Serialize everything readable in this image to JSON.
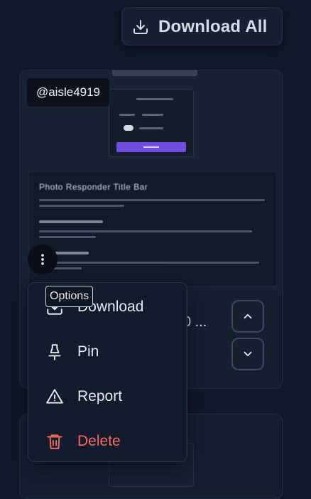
{
  "toolbar": {
    "download_all_label": "Download All",
    "icon": "download-icon"
  },
  "card": {
    "username": "@aisle4919",
    "options_tooltip": "Options",
    "truncated_text": "0 ...",
    "preview": {
      "heading": "Photo Responder Title Bar"
    }
  },
  "menu": {
    "items": [
      {
        "label": "Download",
        "icon": "download-icon"
      },
      {
        "label": "Pin",
        "icon": "pin-icon"
      },
      {
        "label": "Report",
        "icon": "warning-icon"
      },
      {
        "label": "Delete",
        "icon": "trash-icon",
        "color": "#f06a6a"
      }
    ]
  },
  "colors": {
    "background": "#111827",
    "card": "#172033",
    "accent_purple": "#6d4ee0",
    "danger": "#f06a6a"
  }
}
